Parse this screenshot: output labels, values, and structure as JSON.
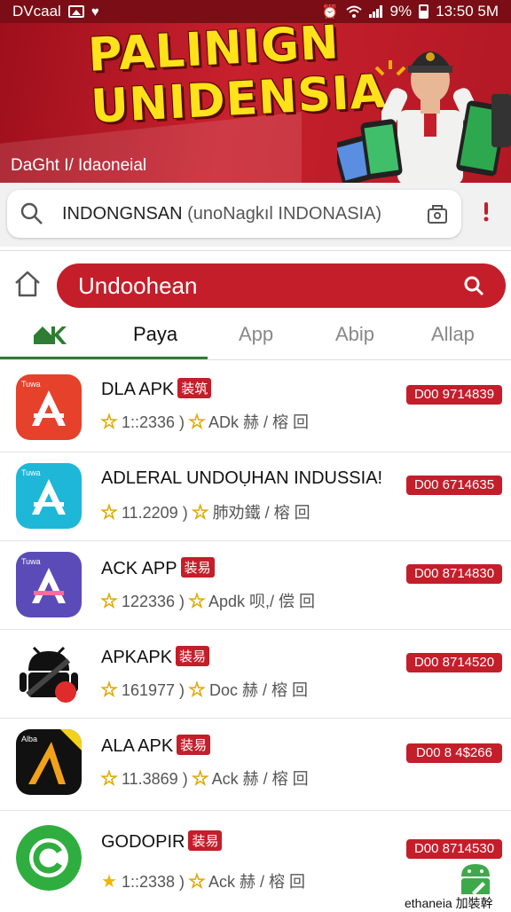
{
  "status_bar": {
    "carrier": "DVcaal",
    "battery_text": "9%",
    "time": "13:50 5M"
  },
  "banner": {
    "title_line1": "PALINIGN",
    "title_line2": "UNIDENSIA",
    "subtitle": "DaGht I/ Idaoneial"
  },
  "search": {
    "query": "INDONGNSAN",
    "hint": "(unoNagkıl  INDONASIA)"
  },
  "nav_pill": {
    "label": "Undoohean"
  },
  "tabs": [
    {
      "label": "Paya"
    },
    {
      "label": "App"
    },
    {
      "label": "Abip"
    },
    {
      "label": "Allap"
    }
  ],
  "apps": [
    {
      "name": "DLA APK",
      "tag": "装筑",
      "rating": "1::2336",
      "meta": "ADk  赫 / 榕 回",
      "badge": "D00 9714839",
      "icon_color": "#e5412b",
      "icon_label": "Tuwa"
    },
    {
      "name": "ADLERAL UNDOỤHAN INDUSSIA!",
      "tag": "",
      "rating": "11.2209",
      "meta": "肺劝鐵 / 榕 回",
      "badge": "D00 6714635",
      "icon_color": "#1fb7d8",
      "icon_label": "Tuwa"
    },
    {
      "name": "ACK APP",
      "tag": "装易",
      "rating": "122336",
      "meta": "Apdk  呗,/ 偿 回",
      "badge": "D00 8714830",
      "icon_color": "#5b4bb8",
      "icon_label": "Tuwa"
    },
    {
      "name": "APKAPK",
      "tag": "装易",
      "rating": "161977",
      "meta": "Doc  赫 / 榕 回",
      "badge": "D00 8714520",
      "icon_color": "#ffffff",
      "icon_label": ""
    },
    {
      "name": "ALA APK",
      "tag": "装易",
      "rating": "11.3869",
      "meta": "Ack  赫 / 榕 回",
      "badge": "D00 8 4$266",
      "icon_color": "#111111",
      "icon_label": "Alba"
    },
    {
      "name": "GODOPIR",
      "tag": "装易",
      "rating": "1::2338",
      "meta": "Ack  赫 / 榕 回",
      "badge": "D00 8714530",
      "icon_color": "#2fae3f",
      "icon_label": ""
    }
  ],
  "footer": {
    "text": "ethaneia 加裝幹"
  },
  "colors": {
    "accent_red": "#c41e2a",
    "status_bar": "#7a0d15",
    "tab_green": "#2e7d32",
    "star": "#f0b400"
  }
}
